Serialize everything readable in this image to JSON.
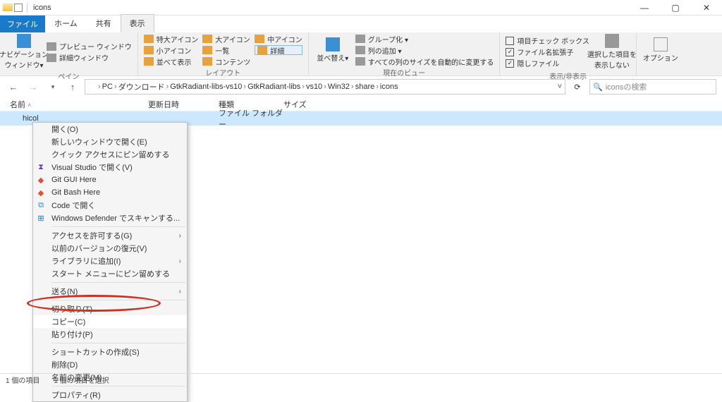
{
  "window": {
    "title": "icons",
    "controls": {
      "min": "—",
      "max": "▢",
      "close": "✕"
    }
  },
  "tabs": {
    "file": "ファイル",
    "home": "ホーム",
    "share": "共有",
    "view": "表示"
  },
  "ribbon": {
    "panes": {
      "nav_window": "ナビゲーション\nウィンドウ▾",
      "preview_window": "プレビュー ウィンドウ",
      "detail_window": "詳細ウィンドウ",
      "label": "ペイン"
    },
    "layout": {
      "xl_icons": "特大アイコン",
      "l_icons": "大アイコン",
      "m_icons": "中アイコン",
      "s_icons": "小アイコン",
      "list": "一覧",
      "details": "詳細",
      "tiles": "並べて表示",
      "contents": "コンテンツ",
      "label": "レイアウト"
    },
    "sort": {
      "sort_by": "並べ替え▾"
    },
    "current_view": {
      "group": "グループ化 ▾",
      "add_columns": "列の追加 ▾",
      "fit_columns": "すべての列のサイズを自動的に変更する",
      "label": "現在のビュー"
    },
    "show_hide": {
      "item_checkboxes": "項目チェック ボックス",
      "file_ext": "ファイル名拡張子",
      "hidden_files": "隠しファイル",
      "hide_selected": "選択した項目を\n表示しない",
      "label": "表示/非表示"
    },
    "options": {
      "options": "オプション"
    }
  },
  "breadcrumb": {
    "items": [
      "PC",
      "ダウンロード",
      "GtkRadiant-libs-vs10",
      "GtkRadiant-libs",
      "vs10",
      "Win32",
      "share",
      "icons"
    ]
  },
  "search": {
    "placeholder": "iconsの検索"
  },
  "columns": {
    "name": "名前",
    "date": "更新日時",
    "type": "種類",
    "size": "サイズ"
  },
  "files": [
    {
      "name": "hicol",
      "date": "",
      "type": "ファイル フォルダー"
    }
  ],
  "status": {
    "count": "1 個の項目",
    "selected": "1 個の項目を選択"
  },
  "context_menu": {
    "open": "開く(O)",
    "open_new_window": "新しいウィンドウで開く(E)",
    "pin_quick_access": "クイック アクセスにピン留めする",
    "open_vs": "Visual Studio で開く(V)",
    "git_gui": "Git GUI Here",
    "git_bash": "Git Bash Here",
    "open_code": "Code で開く",
    "defender_scan": "Windows Defender でスキャンする...",
    "grant_access": "アクセスを許可する(G)",
    "restore_versions": "以前のバージョンの復元(V)",
    "add_to_library": "ライブラリに追加(I)",
    "pin_start": "スタート メニューにピン留めする",
    "send_to": "送る(N)",
    "cut": "切り取り(T)",
    "copy": "コピー(C)",
    "paste": "貼り付け(P)",
    "create_shortcut": "ショートカットの作成(S)",
    "delete": "削除(D)",
    "rename": "名前の変更(M)",
    "properties": "プロパティ(R)"
  }
}
